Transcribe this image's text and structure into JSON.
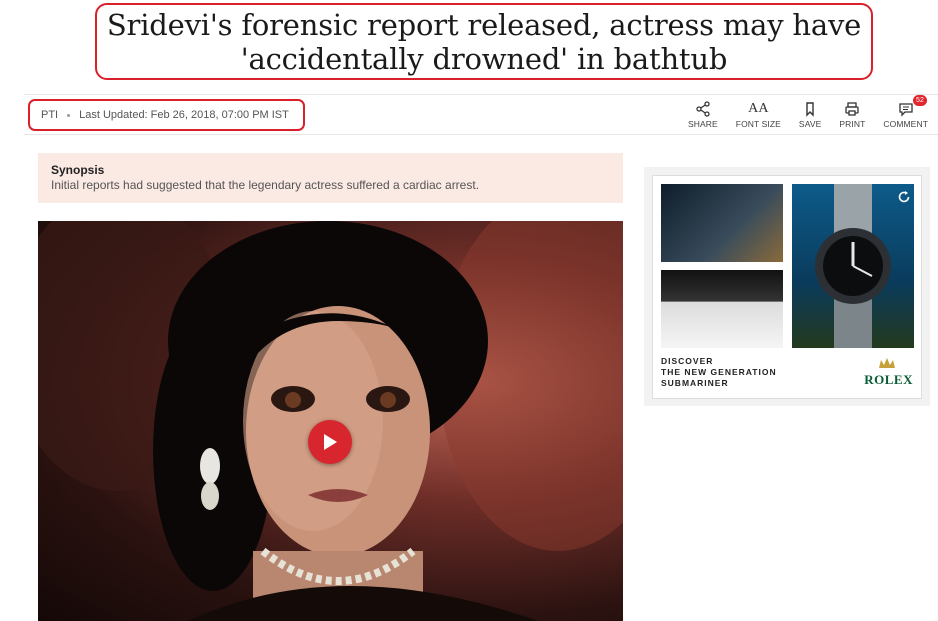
{
  "headline": {
    "line1": "Sridevi's forensic report released, actress may have",
    "line2": "'accidentally drowned' in bathtub"
  },
  "byline": {
    "source": "PTI",
    "updated": "Last Updated: Feb 26, 2018, 07:00 PM IST"
  },
  "toolbar": {
    "share_label": "SHARE",
    "font_size_label": "FONT SIZE",
    "font_size_glyph": "AA",
    "save_label": "SAVE",
    "print_label": "PRINT",
    "comment_label": "COMMENT",
    "comment_count": "52"
  },
  "synopsis": {
    "title": "Synopsis",
    "text": "Initial reports had suggested that the legendary actress suffered a cardiac arrest."
  },
  "ad": {
    "copy_line1": "DISCOVER",
    "copy_line2": "THE NEW GENERATION",
    "copy_line3": "SUBMARINER",
    "brand": "ROLEX",
    "brand_color": "#0a5c36"
  },
  "colors": {
    "accent_red": "#d9202b",
    "synopsis_bg": "#fbe9e4"
  },
  "icons": [
    "share-icon",
    "font-size-icon",
    "bookmark-icon",
    "print-icon",
    "comment-icon",
    "play-icon",
    "crown-icon",
    "refresh-icon"
  ]
}
